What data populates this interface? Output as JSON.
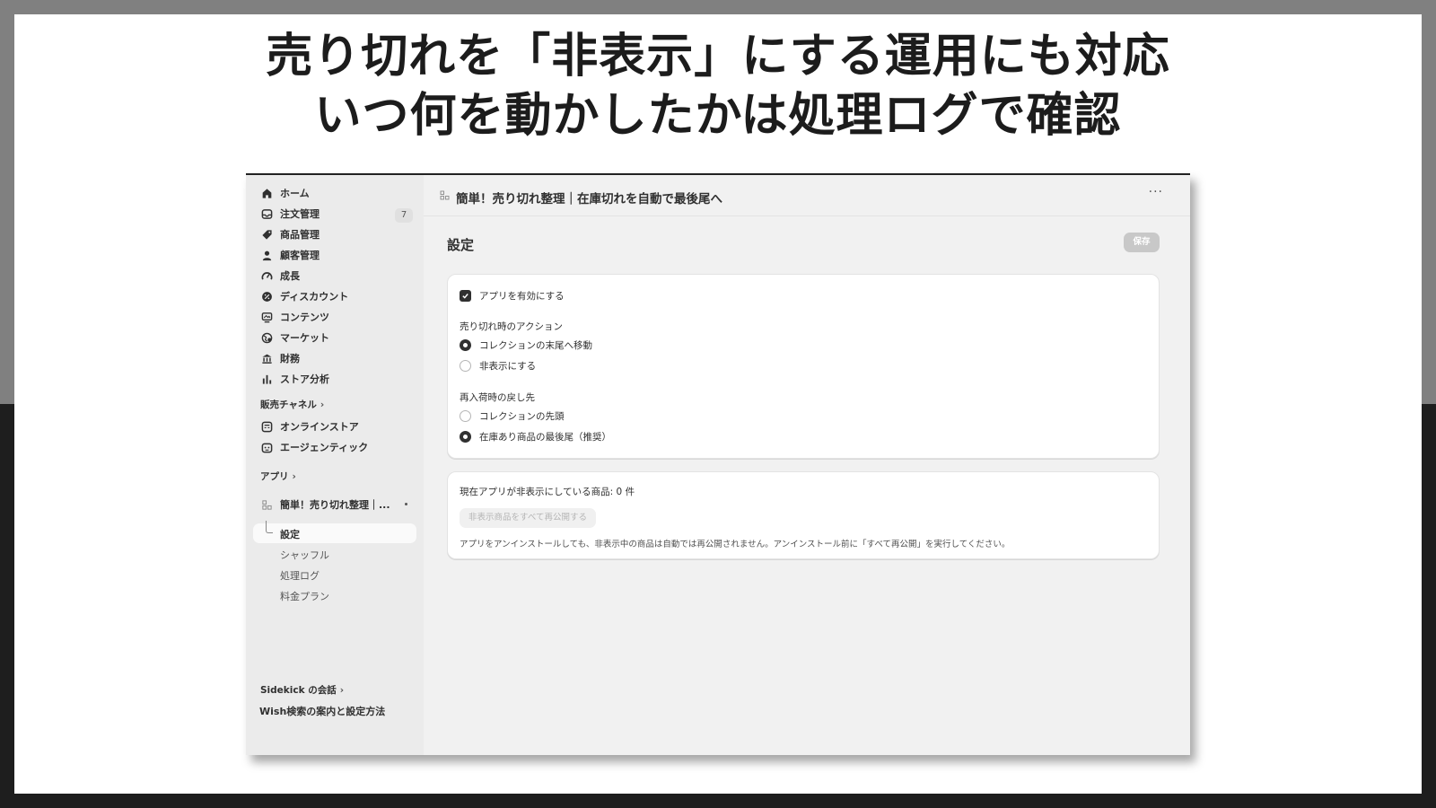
{
  "headline": {
    "line1": "売り切れを「非表示」にする運用にも対応",
    "line2": "いつ何を動かしたかは処理ログで確認"
  },
  "sidebar": {
    "items": [
      {
        "label": "ホーム",
        "icon": "home-icon"
      },
      {
        "label": "注文管理",
        "icon": "inbox-icon",
        "badge": "7"
      },
      {
        "label": "商品管理",
        "icon": "tag-icon"
      },
      {
        "label": "顧客管理",
        "icon": "person-icon"
      },
      {
        "label": "成長",
        "icon": "gauge-icon"
      },
      {
        "label": "ディスカウント",
        "icon": "discount-icon"
      },
      {
        "label": "コンテンツ",
        "icon": "content-icon"
      },
      {
        "label": "マーケット",
        "icon": "globe-icon"
      },
      {
        "label": "財務",
        "icon": "bank-icon"
      },
      {
        "label": "ストア分析",
        "icon": "bar-chart-icon"
      }
    ],
    "sales_channels_label": "販売チャネル",
    "channels": [
      {
        "label": "オンラインストア",
        "icon": "store-icon"
      },
      {
        "label": "エージェンティック",
        "icon": "robot-icon"
      }
    ],
    "apps_label": "アプリ",
    "app_name": "簡単！売り切れ整理｜...",
    "app_subitems": [
      "設定",
      "シャッフル",
      "処理ログ",
      "料金プラン"
    ],
    "footer_sidekick": "Sidekick の会話",
    "footer_wish": "Wish検索の案内と設定方法"
  },
  "main": {
    "app_title": "簡単！売り切れ整理｜在庫切れを自動で最後尾へ",
    "more_label": "···",
    "page_title": "設定",
    "save_label": "保存",
    "enable_label": "アプリを有効にする",
    "soldout_action_label": "売り切れ時のアクション",
    "soldout_options": [
      "コレクションの末尾へ移動",
      "非表示にする"
    ],
    "restock_label": "再入荷時の戻し先",
    "restock_options": [
      "コレクションの先頭",
      "在庫あり商品の最後尾（推奨）"
    ],
    "hidden_count_text": "現在アプリが非表示にしている商品: 0 件",
    "republish_label": "非表示商品をすべて再公開する",
    "note_text": "アプリをアンインストールしても、非表示中の商品は自動では再公開されません。アンインストール前に「すべて再公開」を実行してください。"
  },
  "colors": {
    "accent_dark": "#303030",
    "background_top": "#808080",
    "background_bottom": "#1e1e1e"
  }
}
